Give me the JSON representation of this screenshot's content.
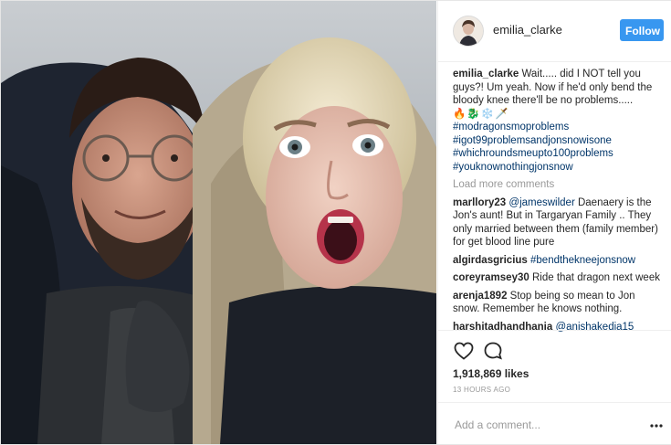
{
  "header": {
    "username": "emilia_clarke",
    "follow_label": "Follow"
  },
  "caption": {
    "username": "emilia_clarke",
    "text": "Wait..... did I NOT tell you guys?! Um yeah. Now if he'd only bend the bloody knee there'll be no problems.....",
    "emojis": "🔥🐉❄️🗡️",
    "hashtags": [
      "#modragonsmoproblems",
      "#igot99problemsandjonsnowisone",
      "#whichroundsmeupto100problems",
      "#youknownothingjonsnow"
    ]
  },
  "load_more_label": "Load more comments",
  "comments": [
    {
      "username": "marllory23",
      "mention": "@jameswilder",
      "text": " Daenaery is the Jon's aunt! But in Targaryan Family .. They only married between them (family member) for get blood line pure"
    },
    {
      "username": "algirdasgricius",
      "mention": "#bendthekneejonsnow",
      "text": ""
    },
    {
      "username": "coreyramsey30",
      "mention": "",
      "text": "Ride that dragon next week"
    },
    {
      "username": "arenja1892",
      "mention": "",
      "text": "Stop being so mean to Jon snow. Remember he knows nothing."
    },
    {
      "username": "harshitadhandhania",
      "mention": "@anishakedia15",
      "text": ""
    }
  ],
  "likes_text": "1,918,869 likes",
  "time_text": "13 HOURS AGO",
  "add_comment_placeholder": "Add a comment...",
  "icons": {
    "like": "heart-outline-icon",
    "comment": "speech-bubble-icon",
    "more": "ellipsis-icon"
  },
  "colors": {
    "follow_button": "#3897f0",
    "link": "#003569",
    "muted": "#999999",
    "text": "#262626"
  }
}
